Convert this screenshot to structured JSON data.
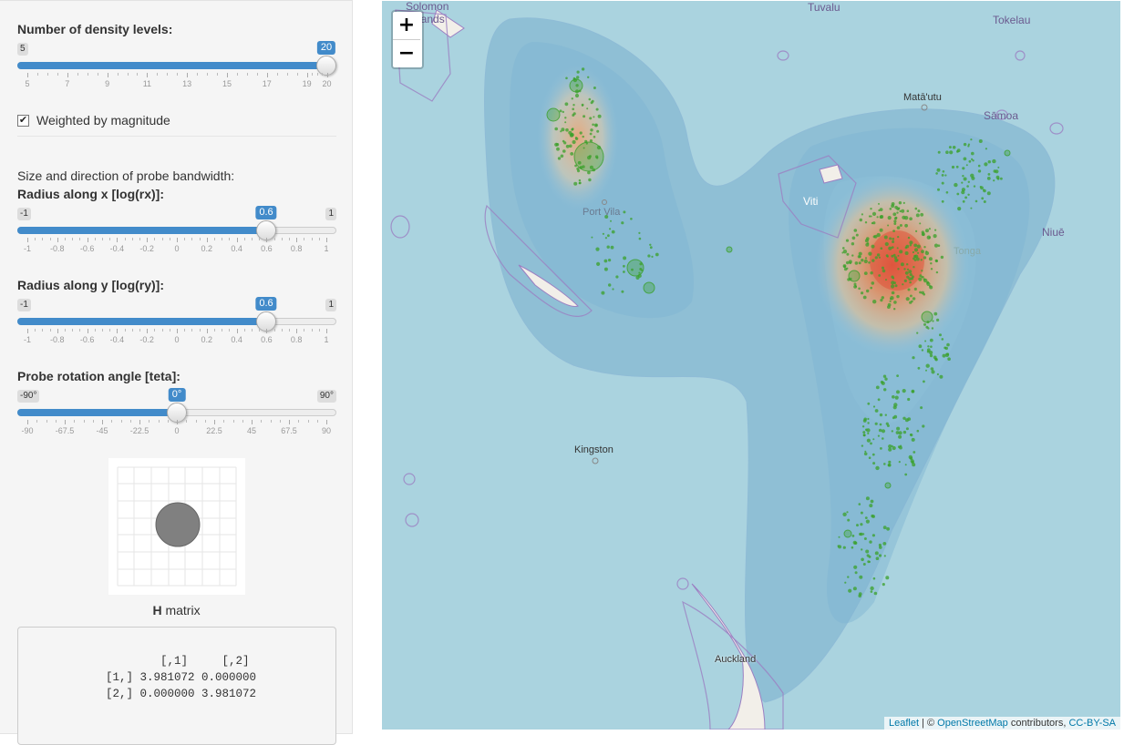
{
  "sidebar": {
    "density": {
      "label": "Number of density levels:",
      "min": "5",
      "max": "20",
      "value": "20",
      "ticks": [
        "5",
        "7",
        "9",
        "11",
        "13",
        "15",
        "17",
        "19",
        "20"
      ]
    },
    "weighted": {
      "label": "Weighted by magnitude",
      "checked": true
    },
    "bandwidth_heading": "Size and direction of probe bandwidth:",
    "rx": {
      "label": "Radius along x [log(rx)]:",
      "min": "-1",
      "max": "1",
      "value": "0.6",
      "ticks": [
        "-1",
        "-0.8",
        "-0.6",
        "-0.4",
        "-0.2",
        "0",
        "0.2",
        "0.4",
        "0.6",
        "0.8",
        "1"
      ]
    },
    "ry": {
      "label": "Radius along y [log(ry)]:",
      "min": "-1",
      "max": "1",
      "value": "0.6",
      "ticks": [
        "-1",
        "-0.8",
        "-0.6",
        "-0.4",
        "-0.2",
        "0",
        "0.2",
        "0.4",
        "0.6",
        "0.8",
        "1"
      ]
    },
    "teta": {
      "label": "Probe rotation angle [teta]:",
      "min": "-90°",
      "max": "90°",
      "value": "0°",
      "ticks": [
        "-90",
        "-67.5",
        "-45",
        "-22.5",
        "0",
        "22.5",
        "45",
        "67.5",
        "90"
      ]
    },
    "h_caption_bold": "H",
    "h_caption_rest": " matrix",
    "matrix_lines": [
      "        [,1]     [,2]",
      "[1,] 3.981072 0.000000",
      "[2,] 0.000000 3.981072"
    ]
  },
  "map": {
    "zoom_in": "+",
    "zoom_out": "−",
    "labels": {
      "solomon": "Solomon\nIslands",
      "tuvalu": "Tuvalu",
      "tokelau": "Tokelau",
      "mata_utu": "Matā'utu",
      "samoa": "Sāmoa",
      "viti": "Viti",
      "niue": "Niuē",
      "port_vila": "Port Vila",
      "kingston": "Kingston",
      "auckland": "Auckland",
      "tonga": "Tonga"
    },
    "attribution": {
      "leaflet": "Leaflet",
      "sep": " | © ",
      "osm": "OpenStreetMap",
      "contrib": " contributors, ",
      "license": "CC-BY-SA"
    },
    "colors": {
      "water": "#aad3df",
      "density_low": "#6ea6c9",
      "density_high": "#e0533a",
      "points": "#3aa02a",
      "border": "#9b7fc2"
    }
  }
}
